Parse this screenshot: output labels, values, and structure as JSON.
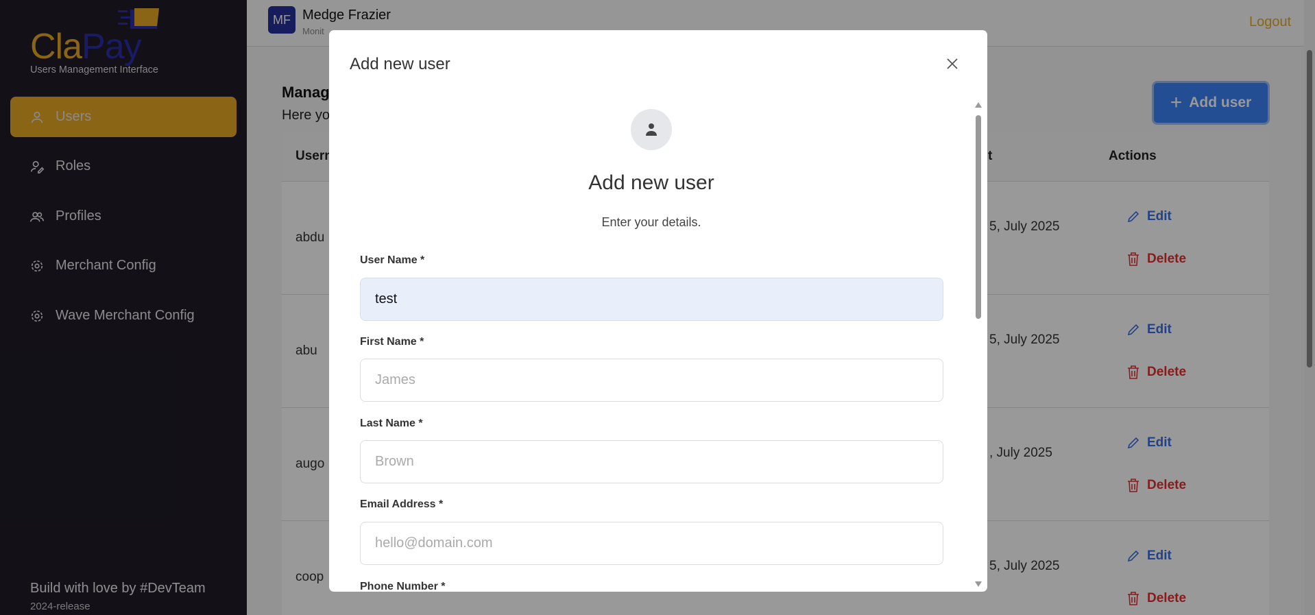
{
  "sidebar": {
    "logo_part1": "Cla",
    "logo_part2": "Pay",
    "tagline": "Users Management Interface",
    "items": [
      {
        "label": "Users",
        "icon": "user-icon",
        "active": true
      },
      {
        "label": "Roles",
        "icon": "user-edit-icon"
      },
      {
        "label": "Profiles",
        "icon": "users-icon"
      },
      {
        "label": "Merchant Config",
        "icon": "gear-icon"
      },
      {
        "label": "Wave Merchant Config",
        "icon": "gear-icon"
      }
    ],
    "footer": "Build with love by #DevTeam",
    "release": "2024-release"
  },
  "header": {
    "initials": "MF",
    "name": "Medge Frazier",
    "subtitle": "Monit",
    "logout": "Logout"
  },
  "page": {
    "title": "Manag",
    "subtitle": "Here yo",
    "add_user": "Add user",
    "columns": [
      "Usern",
      "t",
      "Actions"
    ],
    "rows": [
      {
        "username": "abdu",
        "date": "5, July 2025"
      },
      {
        "username": "abu",
        "date": "5, July 2025"
      },
      {
        "username": "augo",
        "date": ", July 2025"
      },
      {
        "username": "coop",
        "date": "5, July 2025"
      }
    ],
    "edit": "Edit",
    "delete": "Delete"
  },
  "modal": {
    "title": "Add new user",
    "heading": "Add new user",
    "subheading": "Enter your details.",
    "fields": [
      {
        "label": "User Name *",
        "value": "test",
        "placeholder": ""
      },
      {
        "label": "First Name *",
        "value": "",
        "placeholder": "James"
      },
      {
        "label": "Last Name *",
        "value": "",
        "placeholder": "Brown"
      },
      {
        "label": "Email Address *",
        "value": "",
        "placeholder": "hello@domain.com"
      },
      {
        "label": "Phone Number *"
      }
    ]
  },
  "colors": {
    "brand_gold": "#e8a825",
    "brand_navy": "#2a2fa8",
    "primary": "#3b82f6",
    "danger": "#e23030"
  }
}
